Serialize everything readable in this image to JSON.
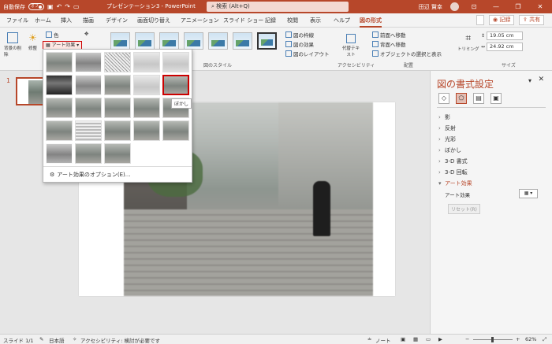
{
  "titlebar": {
    "autosave_label": "自動保存",
    "autosave_state": "オフ",
    "doc_title": "プレゼンテーション3 - PowerPoint",
    "search_placeholder": "検索 (Alt+Q)",
    "user_name": "田辺 賢幸"
  },
  "tabs": [
    "ファイル",
    "ホーム",
    "挿入",
    "描画",
    "デザイン",
    "画面切り替え",
    "アニメーション",
    "スライド ショー",
    "記録",
    "校閲",
    "表示",
    "ヘルプ",
    "図の形式"
  ],
  "tab_buttons": {
    "record": "記録",
    "share": "共有"
  },
  "ribbon": {
    "remove_bg": "背景の削除",
    "corrections": "修整",
    "color": "色",
    "art_effects": "アート効果",
    "style_group_label": "図のスタイル",
    "border": "図の枠線",
    "effects": "図の効果",
    "layout": "図のレイアウト",
    "alt_text": "代替テキスト",
    "accessibility": "アクセシビリティ",
    "bring_forward": "前面へ移動",
    "send_backward": "背面へ移動",
    "selection_pane": "オブジェクトの選択と表示",
    "arrange_label": "配置",
    "crop": "トリミング",
    "height": "19.05 cm",
    "width": "24.92 cm",
    "size_label": "サイズ"
  },
  "gallery": {
    "tooltip": "ぼかし",
    "options_link": "アート効果のオプション(E)..."
  },
  "slides": {
    "number": "1"
  },
  "pane": {
    "title": "図の書式設定",
    "sections": [
      "影",
      "反射",
      "光彩",
      "ぼかし",
      "3-D 書式",
      "3-D 回転",
      "アート効果"
    ],
    "art_effect_label": "アート効果",
    "reset": "リセット(R)"
  },
  "statusbar": {
    "slide": "スライド 1/1",
    "language": "日本語",
    "accessibility": "アクセシビリティ: 検討が必要です",
    "notes": "ノート",
    "zoom": "62%"
  }
}
